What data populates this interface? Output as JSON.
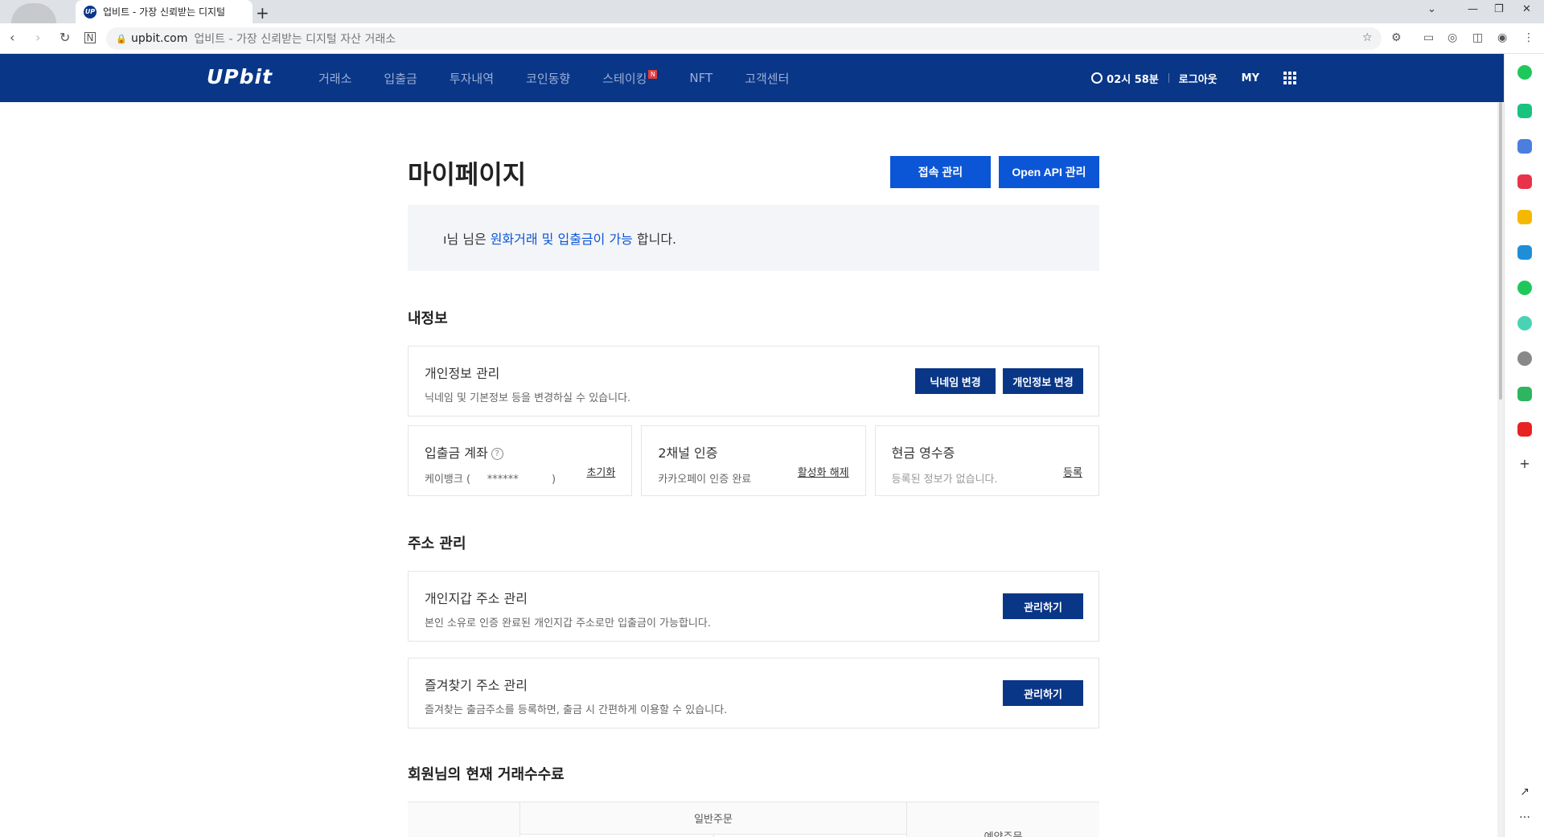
{
  "browser": {
    "tab_title": "업비트 - 가장 신뢰받는 디지털",
    "url_host": "upbit.com",
    "url_title": "업비트 - 가장 신뢰받는 디지털 자산 거래소"
  },
  "header": {
    "logo": "UPbit",
    "menu": [
      "거래소",
      "입출금",
      "투자내역",
      "코인동향",
      "스테이킹",
      "NFT",
      "고객센터"
    ],
    "staking_badge": "N",
    "timer": "02시 58분",
    "logout": "로그아웃",
    "my": "MY"
  },
  "page": {
    "title": "마이페이지",
    "access_btn": "접속 관리",
    "api_btn": "Open API 관리",
    "notice_prefix": "ı님 님은",
    "notice_highlight": "원화거래 및 입출금이 가능",
    "notice_suffix": "합니다."
  },
  "myinfo": {
    "section_title": "내정보",
    "personal_title": "개인정보 관리",
    "personal_sub": "닉네임 및 기본정보 등을 변경하실 수 있습니다.",
    "nickname_btn": "닉네임 변경",
    "personal_btn": "개인정보 변경",
    "account_title": "입출금 계좌",
    "account_help": "?",
    "account_value": "케이뱅크 (     ******          )",
    "account_link": "초기화",
    "auth_title": "2채널 인증",
    "auth_value": "카카오페이 인증 완료",
    "auth_link": "활성화 해제",
    "receipt_title": "현금 영수증",
    "receipt_value": "등록된 정보가 없습니다.",
    "receipt_link": "등록"
  },
  "address": {
    "section_title": "주소 관리",
    "wallet_title": "개인지갑 주소 관리",
    "wallet_sub": "본인 소유로 인증 완료된 개인지갑 주소로만 입출금이 가능합니다.",
    "wallet_btn": "관리하기",
    "fav_title": "즐겨찾기 주소 관리",
    "fav_sub": "즐겨찾는 출금주소를 등록하면, 출금 시 간편하게 이용할 수 있습니다.",
    "fav_btn": "관리하기"
  },
  "fees": {
    "section_title": "회원님의 현재 거래수수료",
    "general": "일반주문",
    "reserve": "예약주문"
  },
  "colors": {
    "navy": "#093687",
    "primary_blue": "#0b56d6"
  }
}
